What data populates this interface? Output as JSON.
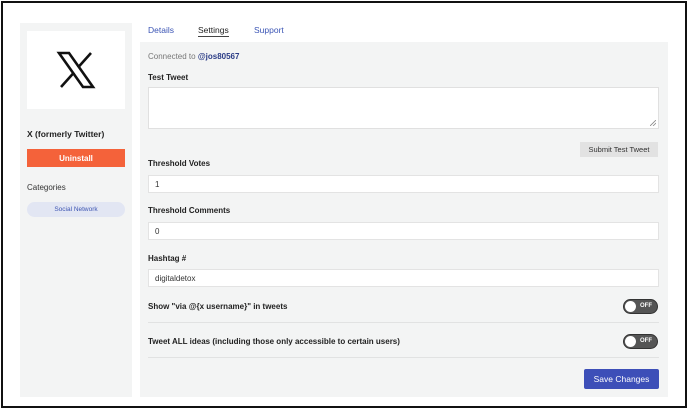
{
  "app": {
    "name": "X (formerly Twitter)",
    "logo_icon": "x-logo-icon",
    "uninstall_label": "Uninstall",
    "categories_heading": "Categories",
    "categories": [
      "Social Network"
    ]
  },
  "tabs": [
    {
      "label": "Details",
      "active": false
    },
    {
      "label": "Settings",
      "active": true
    },
    {
      "label": "Support",
      "active": false
    }
  ],
  "settings": {
    "connected_prefix": "Connected to",
    "connected_handle": "@jos80567",
    "test_tweet_label": "Test Tweet",
    "test_tweet_value": "",
    "submit_test_label": "Submit Test Tweet",
    "threshold_votes_label": "Threshold Votes",
    "threshold_votes_value": "1",
    "threshold_comments_label": "Threshold Comments",
    "threshold_comments_value": "0",
    "hashtag_label": "Hashtag #",
    "hashtag_value": "digitaldetox",
    "toggles": [
      {
        "label": "Show \"via @{x username}\" in tweets",
        "state": "OFF"
      },
      {
        "label": "Tweet ALL ideas (including those only accessible to certain users)",
        "state": "OFF"
      }
    ],
    "save_label": "Save Changes"
  },
  "colors": {
    "accent": "#3d4fb8",
    "uninstall": "#f4623a",
    "tag_bg": "#e2e6f3",
    "tab_link": "#3b55b5"
  }
}
